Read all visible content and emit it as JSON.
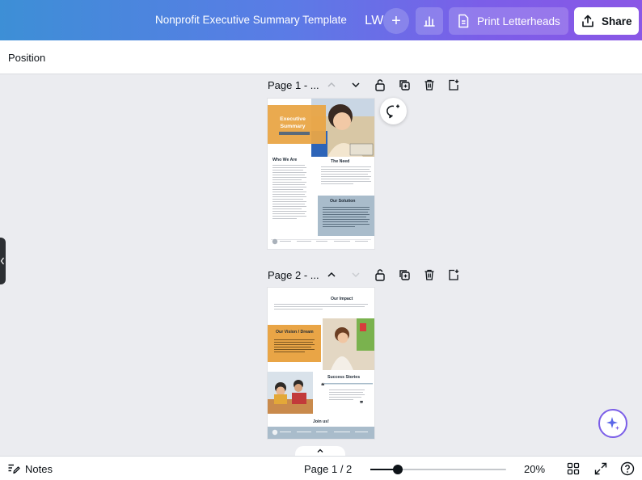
{
  "header": {
    "doc_title": "Nonprofit Executive Summary Template",
    "avatar_initials": "LW",
    "print_label": "Print Letterheads",
    "share_label": "Share",
    "gradient_colors": [
      "#3d8fd6",
      "#7b5ee8"
    ]
  },
  "position_bar": {
    "label": "Position"
  },
  "pages": [
    {
      "title": "Page 1 - ...",
      "content": {
        "heading": "Executive Summary",
        "section_1": "Who We Are",
        "section_2": "The Need",
        "section_3": "Our Solution"
      }
    },
    {
      "title": "Page 2 - ...",
      "content": {
        "section_1": "Our Impact",
        "section_2": "Our Vision / Dream",
        "section_3": "Success Stories",
        "section_4": "Join us!"
      }
    }
  ],
  "footer": {
    "notes_label": "Notes",
    "page_indicator": "Page 1 / 2",
    "zoom_value": "20%",
    "zoom_level": 0.2
  },
  "colors": {
    "accent_orange": "#e9a546",
    "accent_blue": "#a9bccb",
    "brand_purple": "#7b5ee8"
  }
}
